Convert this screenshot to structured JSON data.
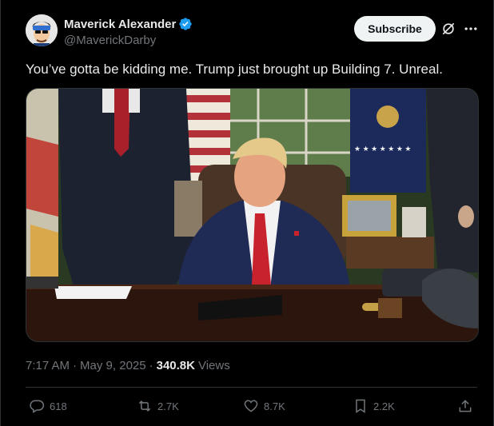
{
  "author": {
    "display_name": "Maverick Alexander",
    "handle": "@MaverickDarby",
    "avatar_icon": "avatar-cartoon-icon",
    "verified_icon": "verified-badge-icon",
    "verified_color": "#1d9bf0"
  },
  "header": {
    "subscribe_label": "Subscribe",
    "grok_icon": "grok-icon",
    "more_icon": "more-dots-icon"
  },
  "tweet": {
    "text": "You’ve gotta be kidding me. Trump just brought up Building 7. Unreal.",
    "media_icon": "video-thumbnail"
  },
  "meta": {
    "time": "7:17 AM",
    "separator": "·",
    "date": "May 9, 2025",
    "separator2": "·",
    "views_count": "340.8K",
    "views_label": "Views"
  },
  "actions": {
    "replies": "618",
    "retweets": "2.7K",
    "likes": "8.7K",
    "bookmarks": "2.2K"
  },
  "colors": {
    "background": "#000000",
    "text": "#e7e9ea",
    "secondary": "#71767b",
    "border": "#2f3336"
  }
}
